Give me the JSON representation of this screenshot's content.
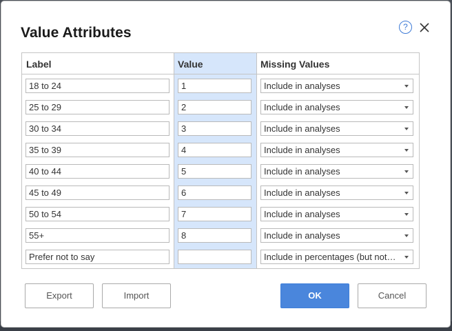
{
  "dialog": {
    "title": "Value Attributes",
    "help_symbol": "?"
  },
  "table": {
    "headers": {
      "label": "Label",
      "value": "Value",
      "missing": "Missing Values"
    },
    "rows": [
      {
        "label": "18 to 24",
        "value": "1",
        "missing": "Include in analyses"
      },
      {
        "label": "25 to 29",
        "value": "2",
        "missing": "Include in analyses"
      },
      {
        "label": "30 to 34",
        "value": "3",
        "missing": "Include in analyses"
      },
      {
        "label": "35 to 39",
        "value": "4",
        "missing": "Include in analyses"
      },
      {
        "label": "40 to 44",
        "value": "5",
        "missing": "Include in analyses"
      },
      {
        "label": "45 to 49",
        "value": "6",
        "missing": "Include in analyses"
      },
      {
        "label": "50 to 54",
        "value": "7",
        "missing": "Include in analyses"
      },
      {
        "label": "55+",
        "value": "8",
        "missing": "Include in analyses"
      },
      {
        "label": "Prefer not to say",
        "value": "",
        "missing": "Include in percentages (but not…"
      }
    ]
  },
  "buttons": {
    "export": "Export",
    "import": "Import",
    "ok": "OK",
    "cancel": "Cancel"
  },
  "colors": {
    "accent": "#4a86dc",
    "value_column_highlight": "#d6e6fb"
  }
}
